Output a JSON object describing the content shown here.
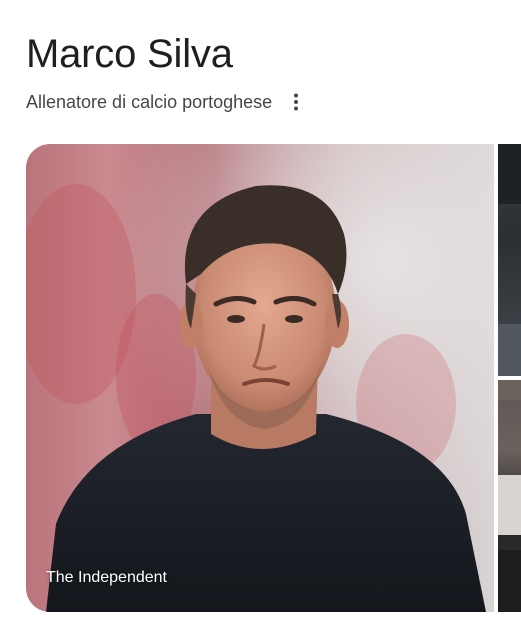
{
  "knowledge_panel": {
    "title": "Marco Silva",
    "subtitle": "Allenatore di calcio portoghese",
    "more_options_icon": "more-vert-icon"
  },
  "images": {
    "main": {
      "source": "The Independent"
    }
  }
}
